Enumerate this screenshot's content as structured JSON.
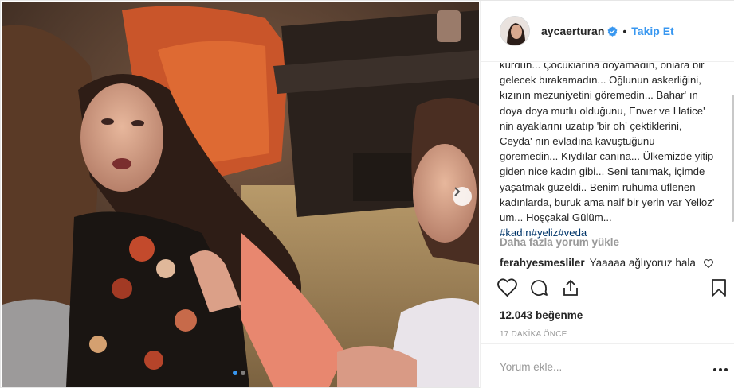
{
  "header": {
    "username": "aycaerturan",
    "bullet": "•",
    "follow_label": "Takip Et"
  },
  "caption": {
    "text": "kurdun... Çocuklarına doyamadın, onlara bir gelecek bırakamadın... Oğlunun askerliğini, kızının mezuniyetini göremedin... Bahar' ın doya doya mutlu olduğunu, Enver ve Hatice' nin ayaklarını uzatıp 'bir oh' çektiklerini, Ceyda' nın evladına kavuştuğunu göremedin... Kıydılar canına... Ülkemizde yitip giden nice kadın gibi... Seni tanımak, içimde yaşatmak güzeldi.. Benim ruhuma üflenen kadınlarda, buruk ama naif bir yerin var Yelloz' um... Hoşçakal Gülüm...",
    "hashtags": [
      "#kadın",
      "#yeliz",
      "#veda"
    ]
  },
  "load_more_label": "Daha fazla yorum yükle",
  "comment": {
    "user": "ferahyesmesliler",
    "text": "Yaaaaa ağlıyoruz hala"
  },
  "likes_label": "12.043 beğenme",
  "time_label": "17 DAKİKA ÖNCE",
  "add_comment": {
    "placeholder": "Yorum ekle..."
  },
  "carousel": {
    "total": 2,
    "active": 1
  },
  "icons": {
    "verified": "verified-badge-icon",
    "next": "chevron-right-icon",
    "like": "heart-icon",
    "comment": "comment-icon",
    "share": "share-icon",
    "save": "bookmark-icon",
    "more": "more-options-icon",
    "comment_like": "heart-small-icon"
  },
  "colors": {
    "link": "#3897f0",
    "hashtag": "#003569",
    "muted": "#999999",
    "text": "#262626"
  }
}
